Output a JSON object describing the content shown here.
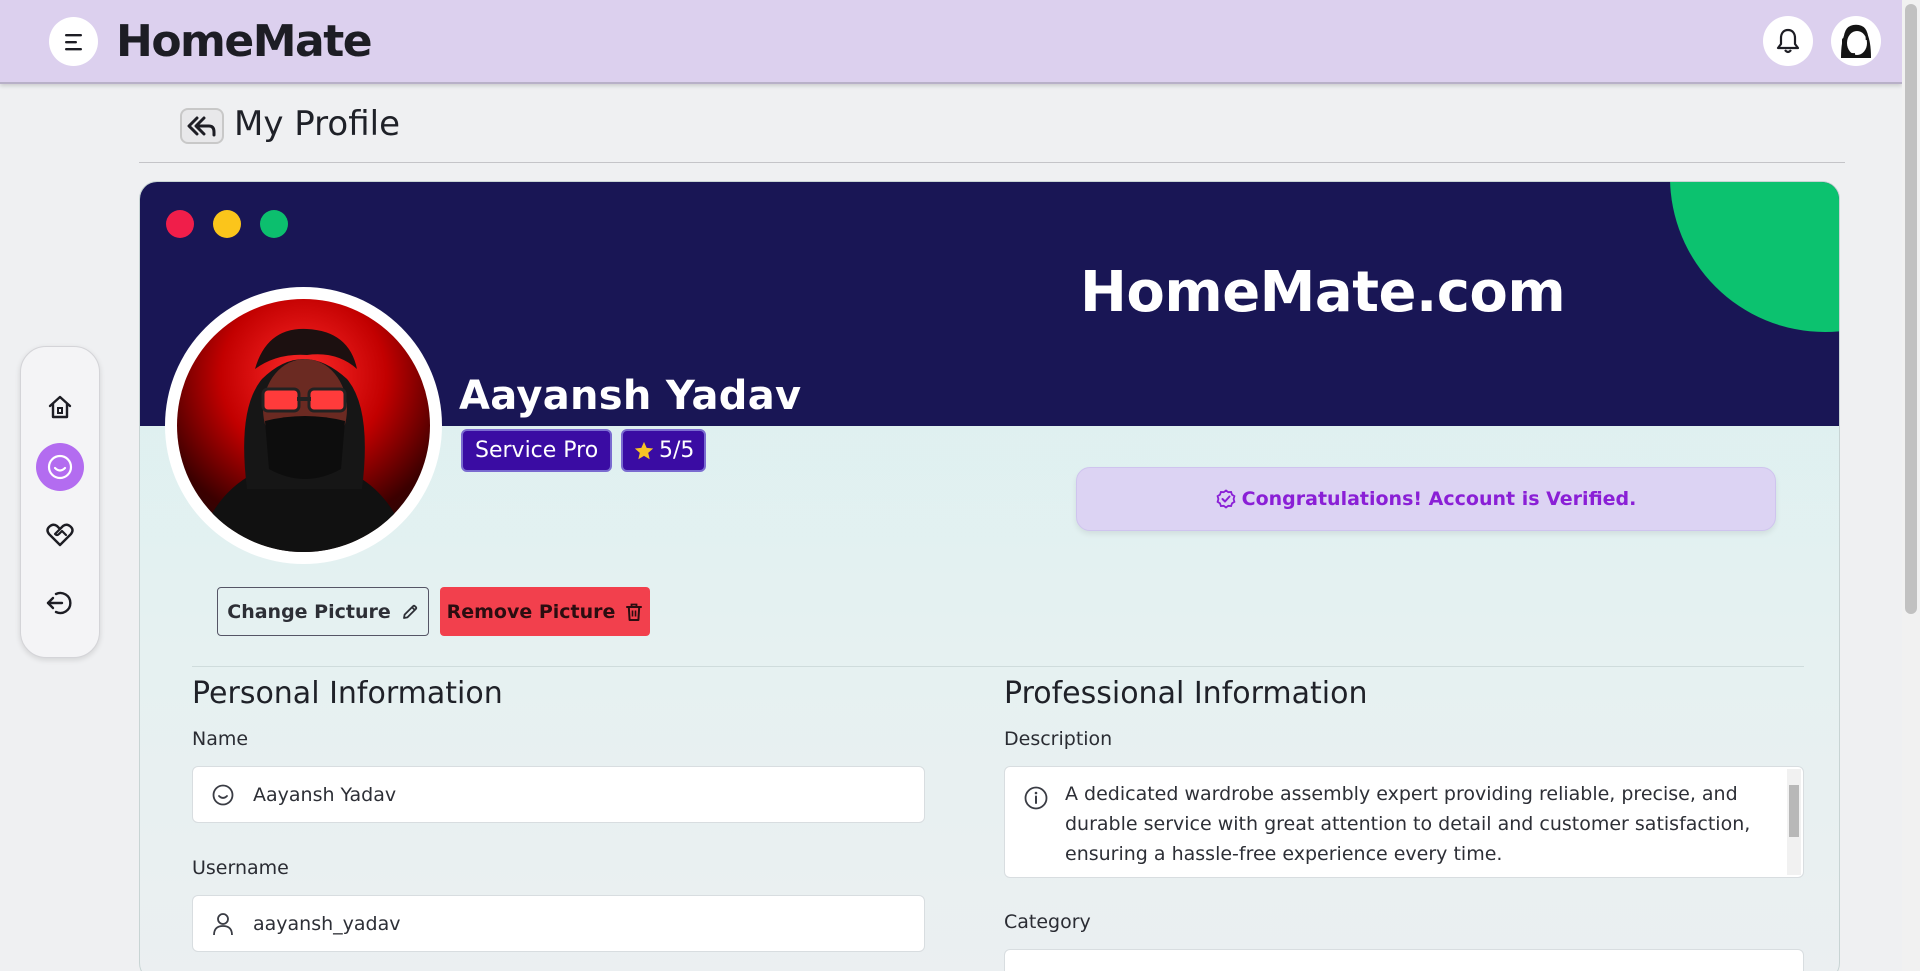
{
  "app": {
    "brand": "HomeMate"
  },
  "page": {
    "title": "My Profile"
  },
  "banner": {
    "site_title": "HomeMate.com",
    "window_dots": [
      "#f01e4a",
      "#fbc51b",
      "#0cbf6e"
    ]
  },
  "profile": {
    "name": "Aayansh Yadav",
    "role_badge": "Service Pro",
    "rating": "5/5",
    "verified_message": "Congratulations! Account is Verified.",
    "change_picture_label": "Change Picture",
    "remove_picture_label": "Remove Picture"
  },
  "personal": {
    "section_title": "Personal Information",
    "name_label": "Name",
    "name_value": "Aayansh Yadav",
    "username_label": "Username",
    "username_value": "aayansh_yadav"
  },
  "professional": {
    "section_title": "Professional Information",
    "description_label": "Description",
    "description_value": "A dedicated wardrobe assembly expert providing reliable, precise, and durable service with great attention to detail and customer satisfaction, ensuring a hassle-free experience every time.",
    "category_label": "Category"
  },
  "sidenav": {
    "items": [
      "home-icon",
      "smile-icon",
      "heart-handshake-icon",
      "logout-icon"
    ],
    "active_index": 1
  },
  "colors": {
    "topbar": "#dcd0ee",
    "banner": "#191655",
    "accent": "#8a1fd6",
    "danger": "#f2404d",
    "badge": "#3a0ca3"
  }
}
